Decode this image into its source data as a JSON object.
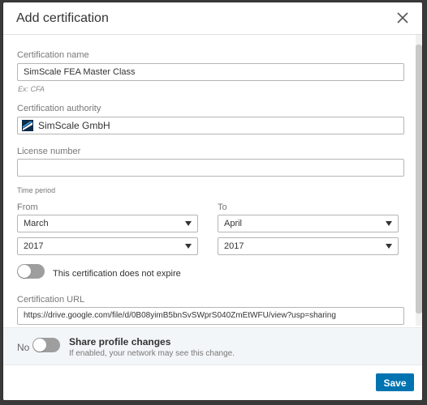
{
  "dialog": {
    "title": "Add certification",
    "close_icon": "close-icon"
  },
  "form": {
    "certification_name": {
      "label": "Certification name",
      "value": "SimScale FEA Master Class",
      "hint": "Ex: CFA"
    },
    "certification_authority": {
      "label": "Certification authority",
      "value": "SimScale GmbH",
      "logo_icon": "simscale-logo-icon"
    },
    "license_number": {
      "label": "License number",
      "value": ""
    },
    "time_period": {
      "label": "Time period",
      "from": {
        "label": "From",
        "month": "March",
        "year": "2017"
      },
      "to": {
        "label": "To",
        "month": "April",
        "year": "2017"
      }
    },
    "no_expire": {
      "label": "This certification does not expire",
      "on": false
    },
    "certification_url": {
      "label": "Certification URL",
      "value": "https://drive.google.com/file/d/0B08yimB5bnSvSWprS040ZmEtWFU/view?usp=sharing"
    }
  },
  "share": {
    "toggle_state": "No",
    "on": false,
    "title": "Share profile changes",
    "description": "If enabled, your network may see this change."
  },
  "footer": {
    "save_label": "Save"
  },
  "colors": {
    "accent": "#0073b1",
    "toggle_off": "#9e9e9e"
  }
}
